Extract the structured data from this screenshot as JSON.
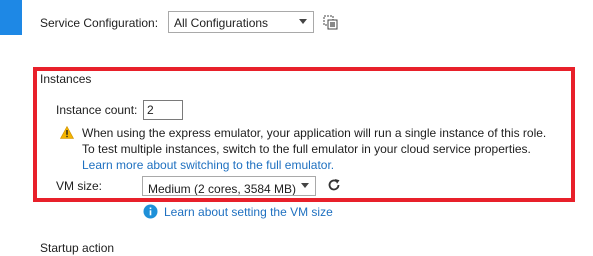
{
  "service_configuration": {
    "label": "Service Configuration:",
    "selected": "All Configurations",
    "icon": "manage-configurations-icon"
  },
  "instances": {
    "header": "Instances",
    "count_label": "Instance count:",
    "count_value": "2",
    "warning": {
      "icon": "warning-icon",
      "line1": "When using the express emulator, your application will run a single instance of this role.",
      "line2": "To test multiple instances, switch to the full emulator in your cloud service properties.",
      "link": "Learn more about switching to the full emulator."
    },
    "vm_size_label": "VM size:",
    "vm_size_selected": "Medium (2 cores, 3584 MB)",
    "vm_info_link": "Learn about setting the VM size"
  },
  "startup": {
    "header": "Startup action"
  },
  "colors": {
    "accent_strip": "#1e88e5",
    "highlight_border": "#e8202a",
    "link": "#1e70c0",
    "warning": "#f5b400",
    "info": "#1e90d8"
  }
}
